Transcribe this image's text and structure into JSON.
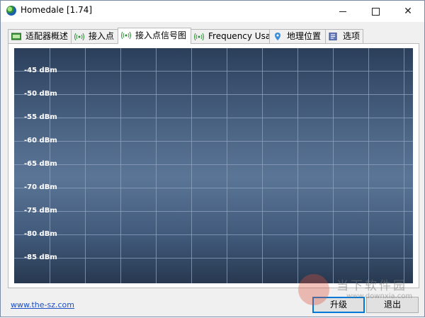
{
  "window": {
    "title": "Homedale [1.74]",
    "app_icon": "globe-icon",
    "controls": {
      "minimize": "minimize-icon",
      "maximize": "maximize-icon",
      "close": "✕"
    }
  },
  "tabs": [
    {
      "label": "适配器概述",
      "icon": "adapter-icon",
      "active": false
    },
    {
      "label": "接入点",
      "icon": "wifi-signal-icon",
      "active": false
    },
    {
      "label": "接入点信号图",
      "icon": "wifi-signal-icon",
      "active": true
    },
    {
      "label": "Frequency Usage",
      "icon": "wifi-signal-icon",
      "active": false
    },
    {
      "label": "地理位置",
      "icon": "location-pin-icon",
      "active": false
    },
    {
      "label": "选项",
      "icon": "options-icon",
      "active": false
    }
  ],
  "chart_data": {
    "type": "line",
    "title": "",
    "xlabel": "",
    "ylabel": "",
    "y_ticks": [
      "-45 dBm",
      "-50 dBm",
      "-55 dBm",
      "-60 dBm",
      "-65 dBm",
      "-70 dBm",
      "-75 dBm",
      "-80 dBm",
      "-85 dBm"
    ],
    "ylim": [
      -90,
      -40
    ],
    "series": [],
    "grid": true
  },
  "footer": {
    "link": "www.the-sz.com",
    "buttons": {
      "upgrade": "升级",
      "exit": "退出"
    }
  },
  "watermark": {
    "text": "当下软件园",
    "sub": "www.downxia.com"
  },
  "colors": {
    "chart_top": "#2b3f5b",
    "chart_mid": "#5b7597",
    "grid": "#8ea3bf",
    "link": "#1a4fc8"
  }
}
